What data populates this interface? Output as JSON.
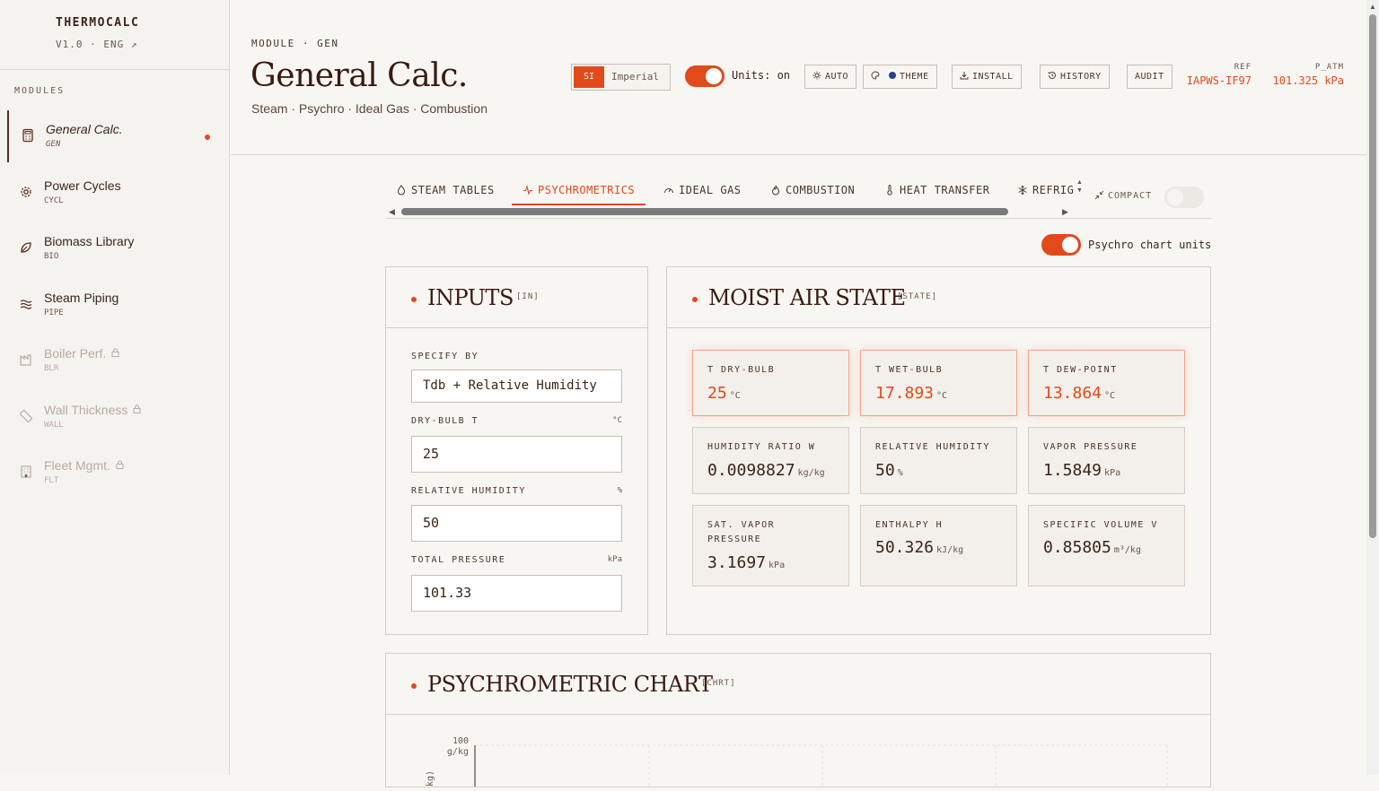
{
  "app": {
    "name": "THERMOCALC",
    "version": "V1.0 · ENG ↗"
  },
  "sidebar": {
    "heading": "MODULES",
    "items": [
      {
        "label": "General Calc.",
        "code": "GEN",
        "icon": "calculator-icon",
        "active": true,
        "locked": false
      },
      {
        "label": "Power Cycles",
        "code": "CYCL",
        "icon": "gear-icon",
        "active": false,
        "locked": false
      },
      {
        "label": "Biomass Library",
        "code": "BIO",
        "icon": "leaf-icon",
        "active": false,
        "locked": false
      },
      {
        "label": "Steam Piping",
        "code": "PIPE",
        "icon": "waves-icon",
        "active": false,
        "locked": false
      },
      {
        "label": "Boiler Perf.",
        "code": "BLR",
        "icon": "factory-icon",
        "active": false,
        "locked": true
      },
      {
        "label": "Wall Thickness",
        "code": "WALL",
        "icon": "ruler-icon",
        "active": false,
        "locked": true
      },
      {
        "label": "Fleet Mgmt.",
        "code": "FLT",
        "icon": "building-icon",
        "active": false,
        "locked": true
      }
    ]
  },
  "header": {
    "breadcrumb": "MODULE · GEN",
    "title": "General Calc.",
    "subtitle": "Steam · Psychro · Ideal Gas · Combustion",
    "unit_system": {
      "si": "SI",
      "imperial": "Imperial",
      "selected": "SI"
    },
    "units_toggle_label": "Units: on",
    "buttons": {
      "auto": "AUTO",
      "theme": "THEME",
      "install": "INSTALL",
      "history": "HISTORY",
      "audit": "AUDIT"
    },
    "ref": {
      "label": "REF",
      "value": "IAPWS-IF97"
    },
    "patm": {
      "label": "P_ATM",
      "value": "101.325 kPa"
    }
  },
  "tabs": {
    "items": [
      "STEAM TABLES",
      "PSYCHROMETRICS",
      "IDEAL GAS",
      "COMBUSTION",
      "HEAT TRANSFER",
      "REFRIG"
    ],
    "active": "PSYCHROMETRICS",
    "compact_label": "COMPACT"
  },
  "psychro_units_label": "Psychro chart units",
  "inputs": {
    "title": "INPUTS",
    "tag": "[IN]",
    "specify_label": "SPECIFY BY",
    "specify_value": "Tdb + Relative Humidity",
    "drybulb_label": "DRY-BULB T",
    "drybulb_unit": "°C",
    "drybulb_value": "25",
    "rh_label": "RELATIVE HUMIDITY",
    "rh_unit": "%",
    "rh_value": "50",
    "pressure_label": "TOTAL PRESSURE",
    "pressure_unit": "kPa",
    "pressure_value": "101.33"
  },
  "state": {
    "title": "MOIST AIR STATE",
    "tag": "[STATE]",
    "cards": [
      {
        "label": "T DRY-BULB",
        "value": "25",
        "unit": "°C"
      },
      {
        "label": "T WET-BULB",
        "value": "17.893",
        "unit": "°C"
      },
      {
        "label": "T DEW-POINT",
        "value": "13.864",
        "unit": "°C"
      },
      {
        "label": "HUMIDITY RATIO W",
        "value": "0.0098827",
        "unit": "kg/kg"
      },
      {
        "label": "RELATIVE HUMIDITY",
        "value": "50",
        "unit": "%"
      },
      {
        "label": "VAPOR PRESSURE",
        "value": "1.5849",
        "unit": "kPa"
      },
      {
        "label": "SAT. VAPOR PRESSURE",
        "value": "3.1697",
        "unit": "kPa"
      },
      {
        "label": "ENTHALPY H",
        "value": "50.326",
        "unit": "kJ/kg"
      },
      {
        "label": "SPECIFIC VOLUME V",
        "value": "0.85805",
        "unit": "m³/kg"
      }
    ]
  },
  "chart": {
    "title": "PSYCHROMETRIC CHART",
    "tag": "[CHRT]",
    "y_tick_top": "100",
    "y_tick_unit": "g/kg",
    "y_axis_fragment": "kg)"
  },
  "colors": {
    "accent": "#e24a1b",
    "text": "#3a2418",
    "bg": "#f8f6f3"
  }
}
